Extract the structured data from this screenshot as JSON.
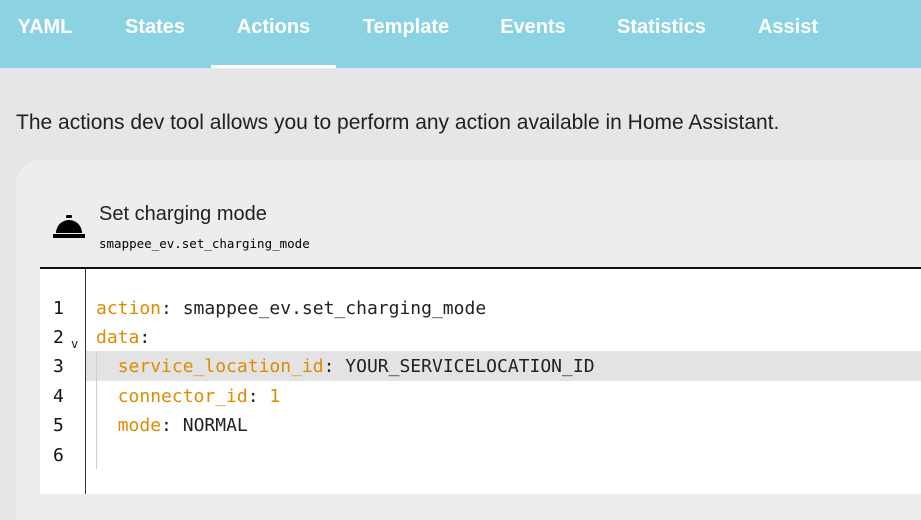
{
  "tabs": [
    {
      "label": "YAML",
      "active": false
    },
    {
      "label": "States",
      "active": false
    },
    {
      "label": "Actions",
      "active": true
    },
    {
      "label": "Template",
      "active": false
    },
    {
      "label": "Events",
      "active": false
    },
    {
      "label": "Statistics",
      "active": false
    },
    {
      "label": "Assist",
      "active": false
    }
  ],
  "description": "The actions dev tool allows you to perform any action available in Home Assistant.",
  "action": {
    "icon": "room-service-bell-icon",
    "name": "Set charging mode",
    "id": "smappee_ev.set_charging_mode"
  },
  "editor": {
    "line_numbers": [
      "1",
      "2",
      "3",
      "4",
      "5",
      "6"
    ],
    "fold_marker": "v",
    "lines": [
      {
        "key": "action",
        "sep": ": ",
        "value": "smappee_ev.set_charging_mode"
      },
      {
        "key": "data",
        "sep": ":",
        "value": ""
      },
      {
        "key": "service_location_id",
        "sep": ": ",
        "value": "YOUR_SERVICELOCATION_ID"
      },
      {
        "key": "connector_id",
        "sep": ": ",
        "value": "1"
      },
      {
        "key": "mode",
        "sep": ": ",
        "value": "NORMAL"
      },
      {
        "key": "",
        "sep": "",
        "value": ""
      }
    ]
  },
  "colors": {
    "tabbar": "#8bd3e3",
    "yaml_key": "#e08a00",
    "background": "#e6e6e9"
  }
}
